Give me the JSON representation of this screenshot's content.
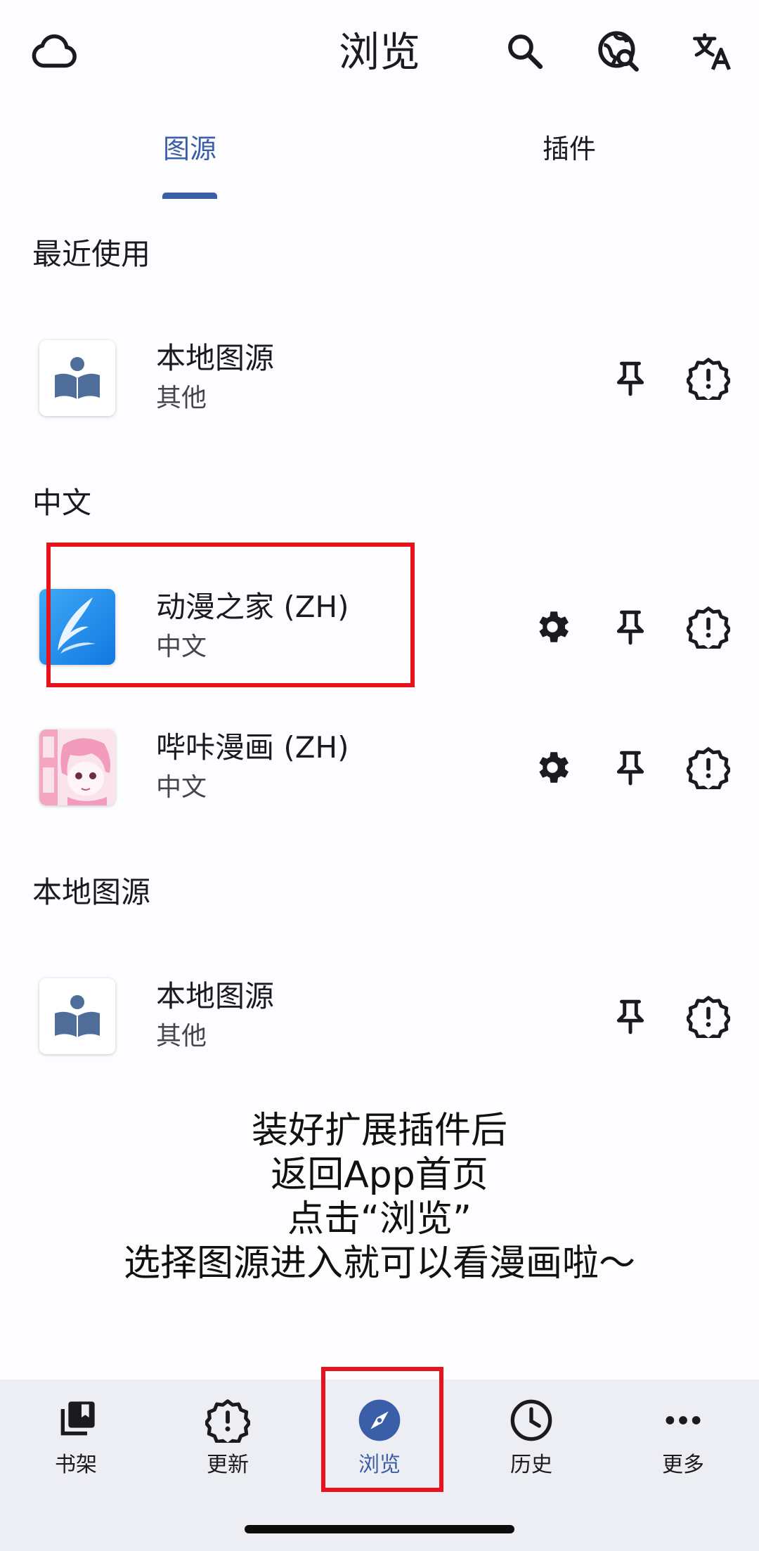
{
  "app_bar": {
    "title": "浏览",
    "icons": [
      "cloud-icon",
      "search-icon",
      "globe-search-icon",
      "translate-icon"
    ]
  },
  "tabs": [
    {
      "label": "图源",
      "active": true
    },
    {
      "label": "插件",
      "active": false
    }
  ],
  "sections": {
    "recent": {
      "header": "最近使用",
      "items": [
        {
          "name": "本地图源",
          "lang": "其他",
          "icon": "local-source-icon",
          "has_settings": false
        }
      ]
    },
    "chinese": {
      "header": "中文",
      "items": [
        {
          "name": "动漫之家 (ZH)",
          "lang": "中文",
          "icon": "dmzj-icon",
          "has_settings": true
        },
        {
          "name": "哔咔漫画 (ZH)",
          "lang": "中文",
          "icon": "picacomic-icon",
          "has_settings": true
        }
      ]
    },
    "local": {
      "header": "本地图源",
      "items": [
        {
          "name": "本地图源",
          "lang": "其他",
          "icon": "local-source-icon",
          "has_settings": false
        }
      ]
    }
  },
  "overlay": {
    "lines": [
      "装好扩展插件后",
      "返回App首页",
      "点击“浏览”",
      "选择图源进入就可以看漫画啦～"
    ]
  },
  "bottom_nav": [
    {
      "label": "书架",
      "icon": "library-icon",
      "active": false
    },
    {
      "label": "更新",
      "icon": "updates-icon",
      "active": false
    },
    {
      "label": "浏览",
      "icon": "compass-icon",
      "active": true
    },
    {
      "label": "历史",
      "icon": "history-icon",
      "active": false
    },
    {
      "label": "更多",
      "icon": "more-icon",
      "active": false
    }
  ],
  "colors": {
    "accent": "#3b5ea8",
    "highlight": "#e8131a",
    "background": "#fdfcff",
    "nav_background": "#edeef3"
  }
}
